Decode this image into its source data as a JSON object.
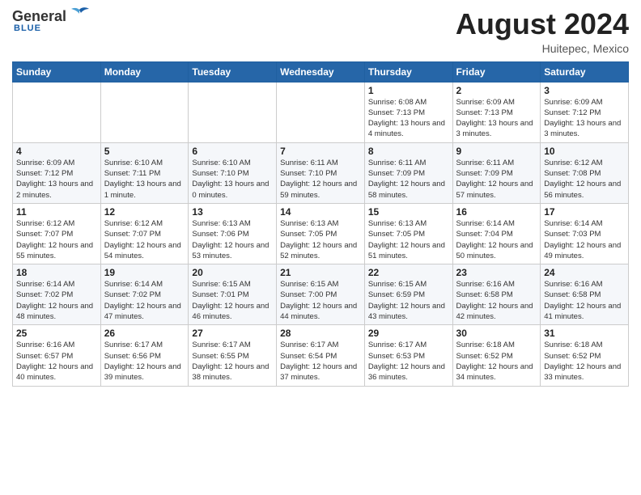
{
  "header": {
    "logo_general": "General",
    "logo_blue": "Blue",
    "logo_subtitle": "Blue",
    "month_title": "August 2024",
    "location": "Huitepec, Mexico"
  },
  "days_of_week": [
    "Sunday",
    "Monday",
    "Tuesday",
    "Wednesday",
    "Thursday",
    "Friday",
    "Saturday"
  ],
  "weeks": [
    [
      {
        "day": "",
        "info": ""
      },
      {
        "day": "",
        "info": ""
      },
      {
        "day": "",
        "info": ""
      },
      {
        "day": "",
        "info": ""
      },
      {
        "day": "1",
        "info": "Sunrise: 6:08 AM\nSunset: 7:13 PM\nDaylight: 13 hours\nand 4 minutes."
      },
      {
        "day": "2",
        "info": "Sunrise: 6:09 AM\nSunset: 7:13 PM\nDaylight: 13 hours\nand 3 minutes."
      },
      {
        "day": "3",
        "info": "Sunrise: 6:09 AM\nSunset: 7:12 PM\nDaylight: 13 hours\nand 3 minutes."
      }
    ],
    [
      {
        "day": "4",
        "info": "Sunrise: 6:09 AM\nSunset: 7:12 PM\nDaylight: 13 hours\nand 2 minutes."
      },
      {
        "day": "5",
        "info": "Sunrise: 6:10 AM\nSunset: 7:11 PM\nDaylight: 13 hours\nand 1 minute."
      },
      {
        "day": "6",
        "info": "Sunrise: 6:10 AM\nSunset: 7:10 PM\nDaylight: 13 hours\nand 0 minutes."
      },
      {
        "day": "7",
        "info": "Sunrise: 6:11 AM\nSunset: 7:10 PM\nDaylight: 12 hours\nand 59 minutes."
      },
      {
        "day": "8",
        "info": "Sunrise: 6:11 AM\nSunset: 7:09 PM\nDaylight: 12 hours\nand 58 minutes."
      },
      {
        "day": "9",
        "info": "Sunrise: 6:11 AM\nSunset: 7:09 PM\nDaylight: 12 hours\nand 57 minutes."
      },
      {
        "day": "10",
        "info": "Sunrise: 6:12 AM\nSunset: 7:08 PM\nDaylight: 12 hours\nand 56 minutes."
      }
    ],
    [
      {
        "day": "11",
        "info": "Sunrise: 6:12 AM\nSunset: 7:07 PM\nDaylight: 12 hours\nand 55 minutes."
      },
      {
        "day": "12",
        "info": "Sunrise: 6:12 AM\nSunset: 7:07 PM\nDaylight: 12 hours\nand 54 minutes."
      },
      {
        "day": "13",
        "info": "Sunrise: 6:13 AM\nSunset: 7:06 PM\nDaylight: 12 hours\nand 53 minutes."
      },
      {
        "day": "14",
        "info": "Sunrise: 6:13 AM\nSunset: 7:05 PM\nDaylight: 12 hours\nand 52 minutes."
      },
      {
        "day": "15",
        "info": "Sunrise: 6:13 AM\nSunset: 7:05 PM\nDaylight: 12 hours\nand 51 minutes."
      },
      {
        "day": "16",
        "info": "Sunrise: 6:14 AM\nSunset: 7:04 PM\nDaylight: 12 hours\nand 50 minutes."
      },
      {
        "day": "17",
        "info": "Sunrise: 6:14 AM\nSunset: 7:03 PM\nDaylight: 12 hours\nand 49 minutes."
      }
    ],
    [
      {
        "day": "18",
        "info": "Sunrise: 6:14 AM\nSunset: 7:02 PM\nDaylight: 12 hours\nand 48 minutes."
      },
      {
        "day": "19",
        "info": "Sunrise: 6:14 AM\nSunset: 7:02 PM\nDaylight: 12 hours\nand 47 minutes."
      },
      {
        "day": "20",
        "info": "Sunrise: 6:15 AM\nSunset: 7:01 PM\nDaylight: 12 hours\nand 46 minutes."
      },
      {
        "day": "21",
        "info": "Sunrise: 6:15 AM\nSunset: 7:00 PM\nDaylight: 12 hours\nand 44 minutes."
      },
      {
        "day": "22",
        "info": "Sunrise: 6:15 AM\nSunset: 6:59 PM\nDaylight: 12 hours\nand 43 minutes."
      },
      {
        "day": "23",
        "info": "Sunrise: 6:16 AM\nSunset: 6:58 PM\nDaylight: 12 hours\nand 42 minutes."
      },
      {
        "day": "24",
        "info": "Sunrise: 6:16 AM\nSunset: 6:58 PM\nDaylight: 12 hours\nand 41 minutes."
      }
    ],
    [
      {
        "day": "25",
        "info": "Sunrise: 6:16 AM\nSunset: 6:57 PM\nDaylight: 12 hours\nand 40 minutes."
      },
      {
        "day": "26",
        "info": "Sunrise: 6:17 AM\nSunset: 6:56 PM\nDaylight: 12 hours\nand 39 minutes."
      },
      {
        "day": "27",
        "info": "Sunrise: 6:17 AM\nSunset: 6:55 PM\nDaylight: 12 hours\nand 38 minutes."
      },
      {
        "day": "28",
        "info": "Sunrise: 6:17 AM\nSunset: 6:54 PM\nDaylight: 12 hours\nand 37 minutes."
      },
      {
        "day": "29",
        "info": "Sunrise: 6:17 AM\nSunset: 6:53 PM\nDaylight: 12 hours\nand 36 minutes."
      },
      {
        "day": "30",
        "info": "Sunrise: 6:18 AM\nSunset: 6:52 PM\nDaylight: 12 hours\nand 34 minutes."
      },
      {
        "day": "31",
        "info": "Sunrise: 6:18 AM\nSunset: 6:52 PM\nDaylight: 12 hours\nand 33 minutes."
      }
    ]
  ]
}
